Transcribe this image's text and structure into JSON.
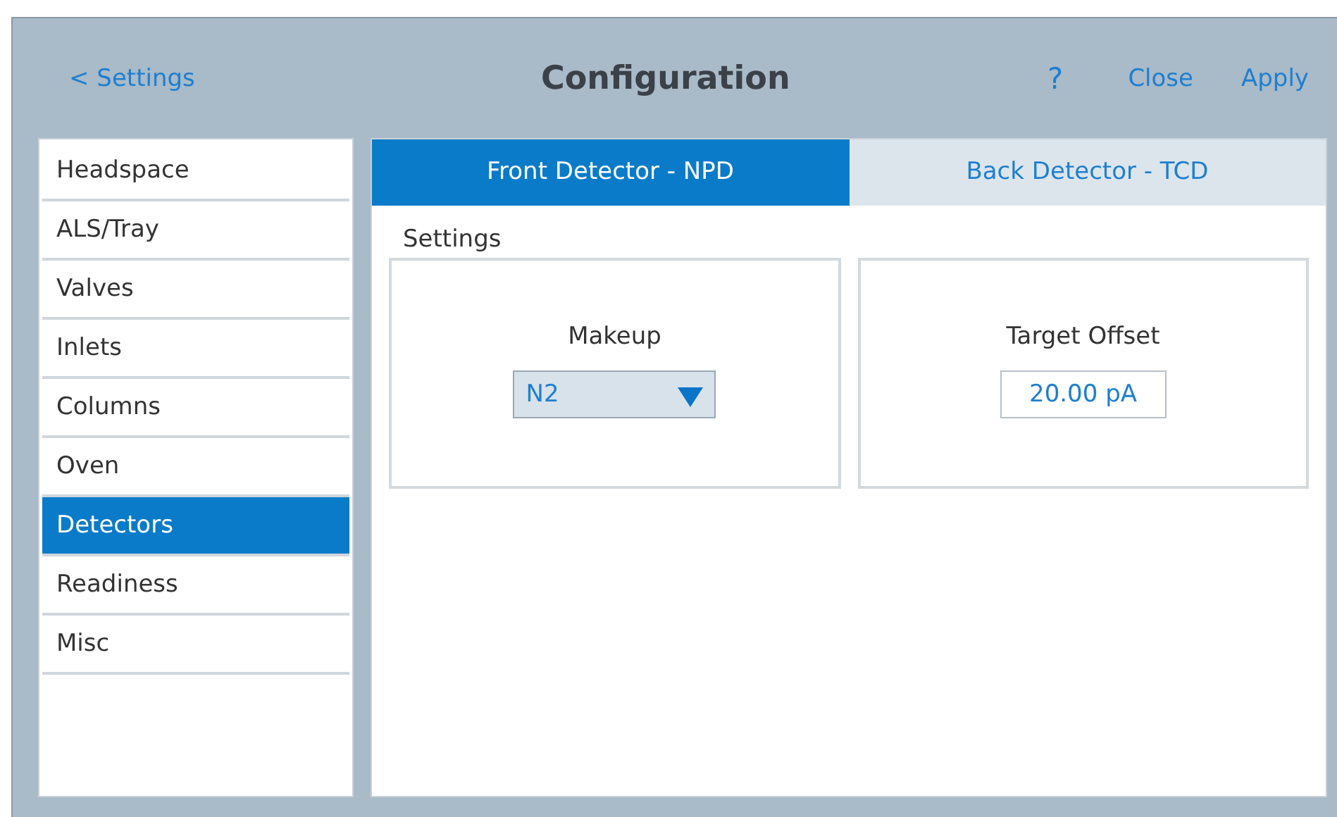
{
  "header": {
    "back": "< Settings",
    "title": "Configuration",
    "help": "?",
    "actions": [
      "Close",
      "Apply"
    ]
  },
  "sidebar": {
    "items": [
      {
        "label": "Headspace",
        "selected": false
      },
      {
        "label": "ALS/Tray",
        "selected": false
      },
      {
        "label": "Valves",
        "selected": false
      },
      {
        "label": "Inlets",
        "selected": false
      },
      {
        "label": "Columns",
        "selected": false
      },
      {
        "label": "Oven",
        "selected": false
      },
      {
        "label": "Detectors",
        "selected": true
      },
      {
        "label": "Readiness",
        "selected": false
      },
      {
        "label": "Misc",
        "selected": false
      }
    ]
  },
  "tabs": [
    {
      "label": "Front Detector - NPD",
      "selected": true
    },
    {
      "label": "Back Detector - TCD",
      "selected": false
    }
  ],
  "section": {
    "title": "Settings",
    "cards": [
      {
        "kind": "select",
        "label": "Makeup",
        "value": "N2"
      },
      {
        "kind": "input",
        "label": "Target Offset",
        "value": "20.00 pA"
      }
    ]
  }
}
